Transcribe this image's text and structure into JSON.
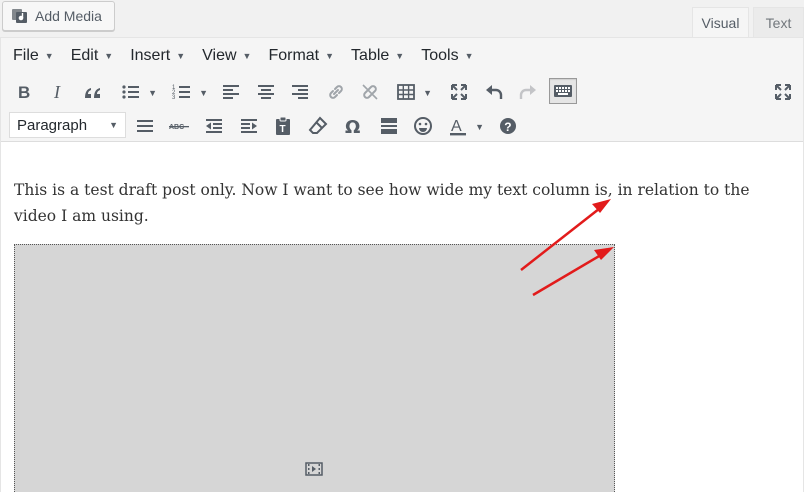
{
  "media": {
    "add_media_label": "Add Media"
  },
  "tabs": {
    "visual": "Visual",
    "text": "Text"
  },
  "menubar": [
    {
      "label": "File"
    },
    {
      "label": "Edit"
    },
    {
      "label": "Insert"
    },
    {
      "label": "View"
    },
    {
      "label": "Format"
    },
    {
      "label": "Table"
    },
    {
      "label": "Tools"
    }
  ],
  "toolbar": {
    "format_select_value": "Paragraph",
    "row1_icons": [
      "bold-icon",
      "italic-icon",
      "blockquote-icon",
      "bullet-list-icon",
      "numbered-list-icon",
      "align-left-icon",
      "align-center-icon",
      "align-right-icon",
      "insert-link-icon",
      "remove-link-icon",
      "table-icon",
      "fullscreen-icon",
      "undo-icon",
      "redo-icon",
      "toolbar-toggle-icon",
      "distraction-free-icon"
    ],
    "row2_icons": [
      "horizontal-rule-icon",
      "strikethrough-icon",
      "outdent-icon",
      "indent-icon",
      "paste-as-text-icon",
      "clear-formatting-icon",
      "special-character-icon",
      "read-more-icon",
      "emoticons-icon",
      "text-color-icon",
      "help-icon"
    ]
  },
  "content": {
    "paragraph": "This is a test draft post only. Now I want to see how wide my text column is, in relation to the video I am using."
  },
  "colors": {
    "annotation_arrow": "#e21b1b",
    "toolbar_bg": "#f5f5f5",
    "video_placeholder": "#d6d6d6"
  }
}
